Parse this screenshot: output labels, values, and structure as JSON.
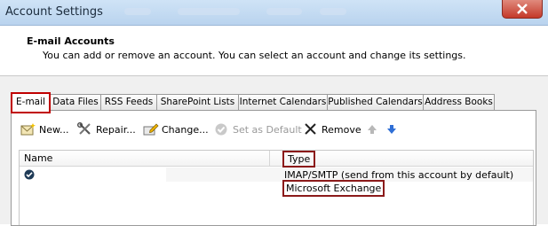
{
  "window": {
    "title": "Account Settings",
    "colors": {
      "titlebar": "#c5dcf2",
      "close": "#c4392a",
      "highlight": "#c00000"
    }
  },
  "header": {
    "title": "E-mail Accounts",
    "subtitle": "You can add or remove an account. You can select an account and change its settings."
  },
  "tabs": [
    {
      "label": "E-mail",
      "active": true
    },
    {
      "label": "Data Files"
    },
    {
      "label": "RSS Feeds"
    },
    {
      "label": "SharePoint Lists"
    },
    {
      "label": "Internet Calendars"
    },
    {
      "label": "Published Calendars"
    },
    {
      "label": "Address Books"
    }
  ],
  "toolbar": {
    "new": "New...",
    "repair": "Repair...",
    "change": "Change...",
    "set_default": "Set as Default",
    "remove": "Remove"
  },
  "list": {
    "columns": {
      "name": "Name",
      "type": "Type"
    },
    "rows": [
      {
        "name": "",
        "type": "IMAP/SMTP (send from this account by default)",
        "default": true
      },
      {
        "name": "",
        "type": "Microsoft Exchange"
      }
    ]
  }
}
